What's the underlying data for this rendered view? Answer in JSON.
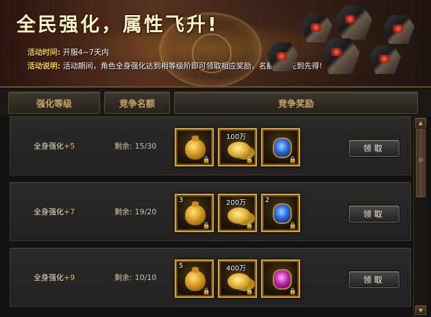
{
  "banner": {
    "title": "全民强化，属性飞升!",
    "time_key": "活动时间:",
    "time_value": "开服4~7天内",
    "desc_key": "活动说明:",
    "desc_value": "活动期间，角色全身强化达到相等级阶即可领取相应奖励，名额有限先到先得!"
  },
  "headers": {
    "level": "强化等级",
    "quota": "竞争名额",
    "reward": "竞争奖励"
  },
  "rows": [
    {
      "label": "全身强化",
      "plus": "+5",
      "remain_label": "剩余:",
      "remain_value": "15/30",
      "items": [
        {
          "icon": "gold-bag-icon",
          "count": ""
        },
        {
          "icon": "gold-coins-icon",
          "count": "100万"
        },
        {
          "icon": "blue-gem-icon",
          "count": ""
        }
      ],
      "button": "领取"
    },
    {
      "label": "全身强化",
      "plus": "+7",
      "remain_label": "剩余:",
      "remain_value": "19/20",
      "items": [
        {
          "icon": "gold-bag-icon",
          "count": "3"
        },
        {
          "icon": "gold-coins-icon",
          "count": "200万"
        },
        {
          "icon": "blue-gem-icon",
          "count": "2"
        }
      ],
      "button": "领取"
    },
    {
      "label": "全身强化",
      "plus": "+9",
      "remain_label": "剩余:",
      "remain_value": "10/10",
      "items": [
        {
          "icon": "gold-bag-icon",
          "count": "5"
        },
        {
          "icon": "gold-coins-icon",
          "count": "400万"
        },
        {
          "icon": "purple-gem-icon",
          "count": ""
        }
      ],
      "button": "领取"
    }
  ],
  "lock_glyph": "🔒",
  "scroll_up": "▲",
  "scroll_down": "▼"
}
